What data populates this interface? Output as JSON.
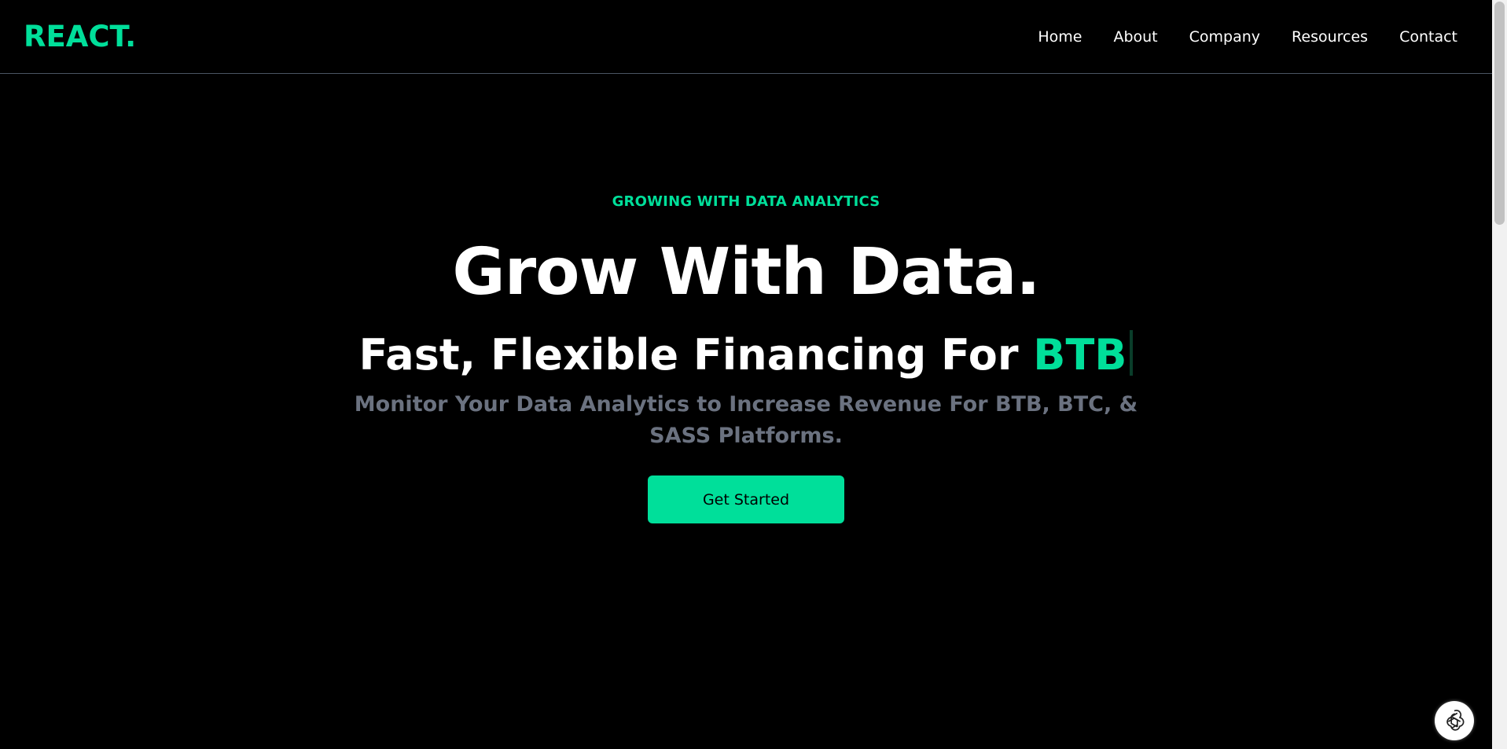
{
  "brand": {
    "logo": "REACT.",
    "accent_color": "#00df9a"
  },
  "nav": {
    "items": [
      {
        "label": "Home"
      },
      {
        "label": "About"
      },
      {
        "label": "Company"
      },
      {
        "label": "Resources"
      },
      {
        "label": "Contact"
      }
    ]
  },
  "hero": {
    "eyebrow": "GROWING WITH DATA ANALYTICS",
    "headline": "Grow With Data.",
    "subline_prefix": "Fast, Flexible Financing For ",
    "typed_word": "BTB",
    "description": "Monitor Your Data Analytics to Increase Revenue For BTB, BTC, & SASS Platforms.",
    "cta_label": "Get Started"
  },
  "widgets": {
    "chat_icon": "openai-logo-icon"
  }
}
